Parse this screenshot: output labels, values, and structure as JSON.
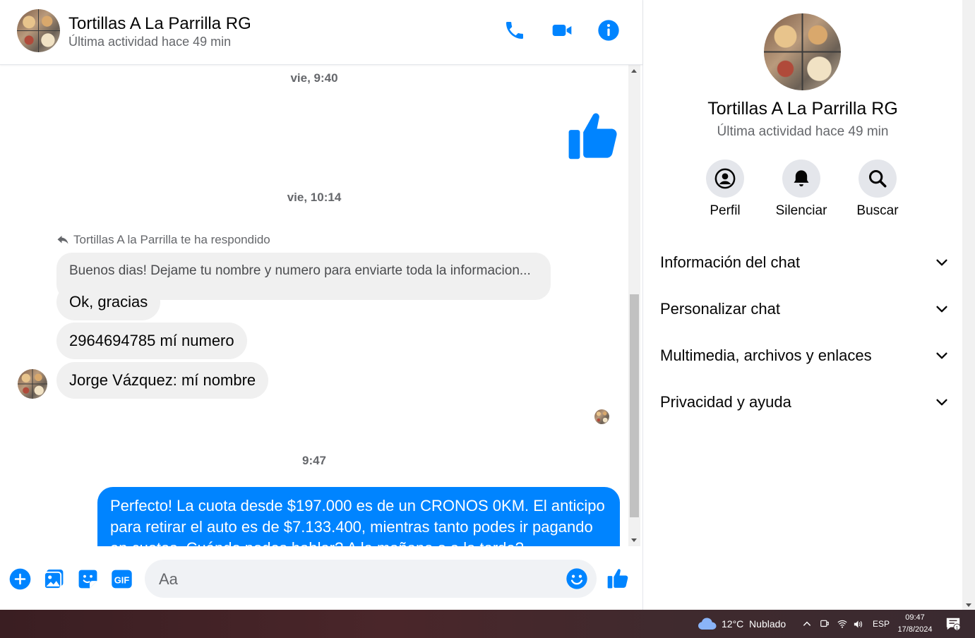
{
  "contact": {
    "name": "Tortillas A La Parrilla RG",
    "status": "Última actividad hace 49 min"
  },
  "header_icons": [
    "phone-icon",
    "video-camera-icon",
    "info-icon"
  ],
  "messages": {
    "timestamp_1": "vie, 9:40",
    "timestamp_2": "vie, 10:14",
    "reply_note": "Tortillas A la Parrilla te ha respondido",
    "quoted_message": "Buenos dias! Dejame tu nombre y numero para enviarte toda la informacion...",
    "incoming": [
      "Ok, gracias",
      "2964694785 mí numero",
      "Jorge Vázquez: mí nombre"
    ],
    "timestamp_3": "9:47",
    "outgoing": "Perfecto! La cuota desde $197.000 es de un CRONOS 0KM. El anticipo para retirar el auto es de $7.133.400, mientras tanto podes ir pagando en cuotas. Cuándo podes hablar? A la mañana o a la tarde?"
  },
  "composer": {
    "placeholder": "Aa",
    "icons": [
      "plus-icon",
      "image-icon",
      "sticker-icon",
      "gif-icon",
      "emoji-icon",
      "like-icon"
    ],
    "gif_label": "GIF"
  },
  "info_panel": {
    "name": "Tortillas A La Parrilla RG",
    "status": "Última actividad hace 49 min",
    "actions": [
      {
        "label": "Perfil",
        "icon": "profile-icon"
      },
      {
        "label": "Silenciar",
        "icon": "bell-icon"
      },
      {
        "label": "Buscar",
        "icon": "search-icon"
      }
    ],
    "sections": [
      "Información del chat",
      "Personalizar chat",
      "Multimedia, archivos y enlaces",
      "Privacidad y ayuda"
    ]
  },
  "taskbar": {
    "weather": "12°C  Nublado",
    "language": "ESP",
    "time": "09:47",
    "date": "17/8/2024",
    "notification_count": "1"
  },
  "colors": {
    "accent": "#0084ff",
    "incoming_bubble": "#f0f0f0",
    "secondary_text": "#65676b"
  }
}
